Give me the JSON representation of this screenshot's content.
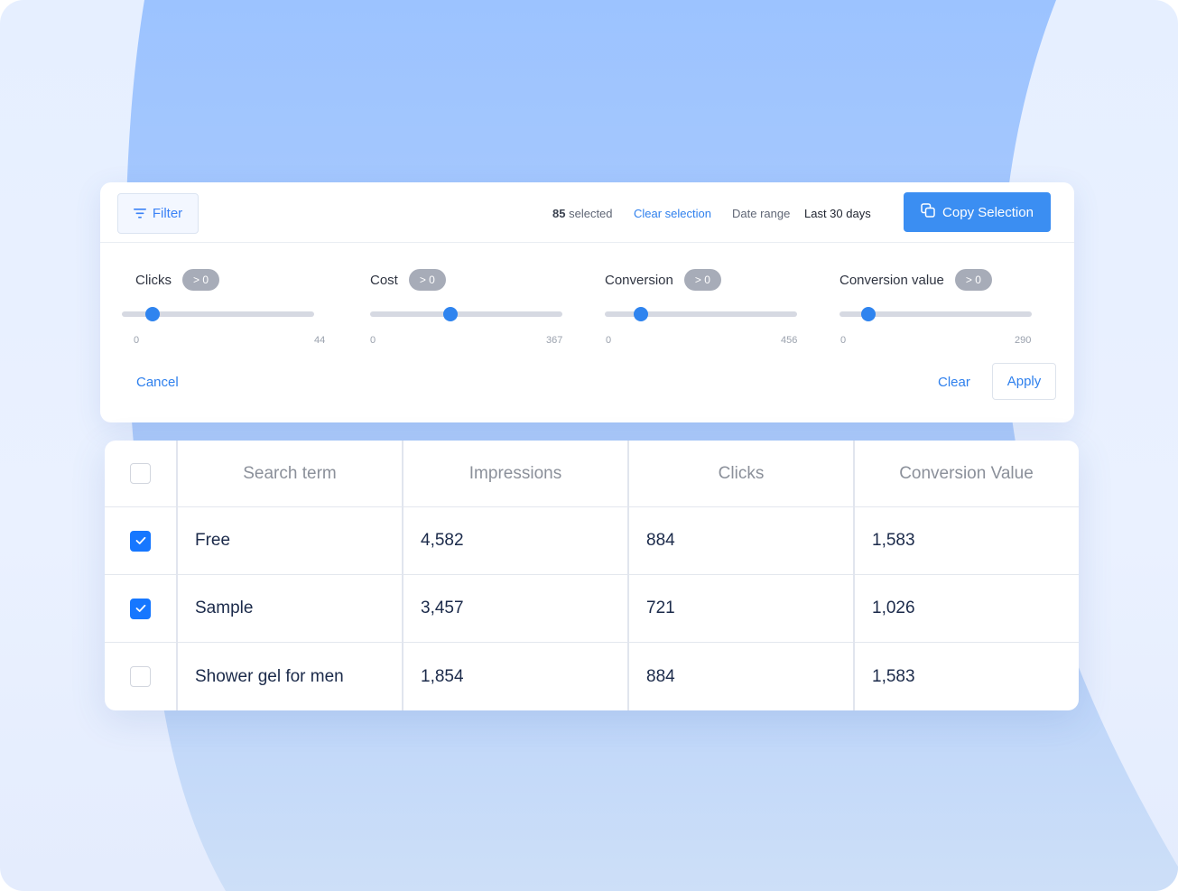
{
  "toolbar": {
    "filter_label": "Filter",
    "selected_count": "85",
    "selected_suffix": "selected",
    "clear_selection_label": "Clear selection",
    "date_range_label": "Date range",
    "date_range_value": "Last 30 days",
    "copy_selection_label": "Copy Selection"
  },
  "filters": [
    {
      "label": "Clicks",
      "badge": "> 0",
      "min": "0",
      "max": "44",
      "value_fraction": 0.16
    },
    {
      "label": "Cost",
      "badge": "> 0",
      "min": "0",
      "max": "367",
      "value_fraction": 0.42
    },
    {
      "label": "Conversion",
      "badge": "> 0",
      "min": "0",
      "max": "456",
      "value_fraction": 0.19
    },
    {
      "label": "Conversion value",
      "badge": "> 0",
      "min": "0",
      "max": "290",
      "value_fraction": 0.15
    }
  ],
  "actions": {
    "cancel_label": "Cancel",
    "clear_label": "Clear",
    "apply_label": "Apply"
  },
  "table": {
    "columns": [
      "Search term",
      "Impressions",
      "Clicks",
      "Conversion Value"
    ],
    "rows": [
      {
        "checked": true,
        "cells": [
          "Free",
          "4,582",
          "884",
          "1,583"
        ]
      },
      {
        "checked": true,
        "cells": [
          "Sample",
          "3,457",
          "721",
          "1,026"
        ]
      },
      {
        "checked": false,
        "cells": [
          "Shower gel for men",
          "1,854",
          "884",
          "1,583"
        ]
      }
    ]
  },
  "colors": {
    "accent": "#3b8ef2",
    "checkbox_checked": "#1677ff",
    "badge": "#a7acb8"
  }
}
